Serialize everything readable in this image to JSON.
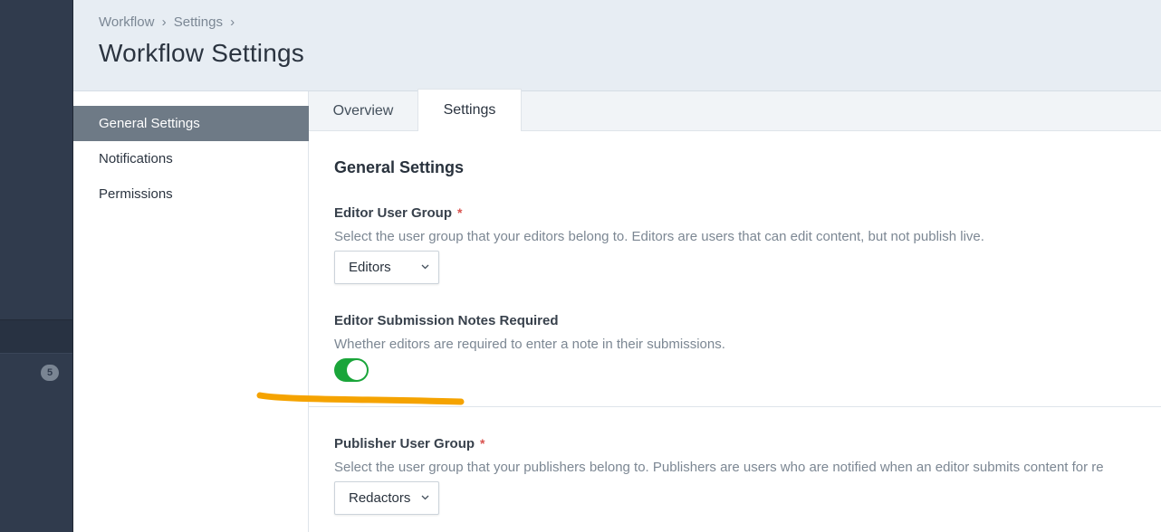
{
  "sidebar": {
    "badge_count": "5"
  },
  "header": {
    "breadcrumb": [
      "Workflow",
      "›",
      "Settings",
      "›"
    ],
    "title": "Workflow Settings"
  },
  "submenu": {
    "items": [
      {
        "label": "General Settings",
        "active": true
      },
      {
        "label": "Notifications",
        "active": false
      },
      {
        "label": "Permissions",
        "active": false
      }
    ]
  },
  "tabs": [
    {
      "label": "Overview",
      "active": false
    },
    {
      "label": "Settings",
      "active": true
    }
  ],
  "main": {
    "section_title": "General Settings",
    "required_marker": "*",
    "editor_group": {
      "label": "Editor User Group",
      "description": "Select the user group that your editors belong to. Editors are users that can edit content, but not publish live.",
      "value": "Editors"
    },
    "notes_required": {
      "label": "Editor Submission Notes Required",
      "description": "Whether editors are required to enter a note in their submissions.",
      "enabled": true
    },
    "publisher_group": {
      "label": "Publisher User Group",
      "description": "Select the user group that your publishers belong to. Publishers are users who are notified when an editor submits content for re",
      "value": "Redactors"
    }
  },
  "colors": {
    "sidebar_bg": "#303b4d",
    "header_bg": "#e7edf3",
    "active_menu_bg": "#6e7a86",
    "toggle_on": "#1aa53a",
    "required": "#d9534f",
    "annotation": "#f5a300"
  },
  "icons": {
    "select_chevron": "chevron-down-icon"
  }
}
